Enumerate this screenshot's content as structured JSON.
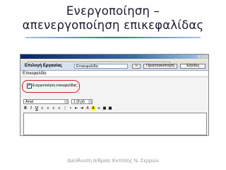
{
  "slide": {
    "title_line1": "Ενεργοποίηση –",
    "title_line2": "απενεργοποίηση επικεφαλίδας",
    "footer": "Διεύθυνση Α/θμιας Εκπ/σης Ν. Σερρών"
  },
  "app": {
    "window_title": "",
    "toolbar": {
      "task_label": "Επιλογή Εργασίας",
      "task_value": "Επικεφαλίδα",
      "go_label": "⇒",
      "preview_label": "Προεπισκόπηση",
      "exit_label": "Έξοδος"
    },
    "panel": {
      "header": "Επικεφαλίδα",
      "checkbox_label": "Ενεργοποίηση επικεφαλίδας",
      "checkbox_checked": true,
      "font_value": "Arial",
      "size_value": "1 (8 pt)"
    }
  },
  "colors": {
    "highlight": "#d42020",
    "toolbar_bg": "#d6e0ee"
  }
}
